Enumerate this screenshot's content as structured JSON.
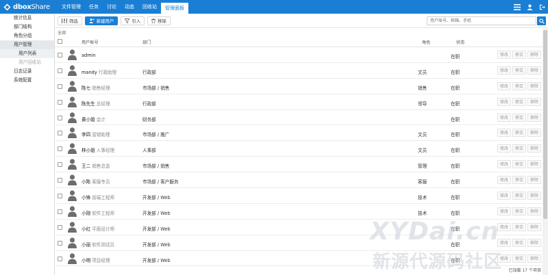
{
  "brand": {
    "name_bold": "dbox",
    "name_rest": "Share"
  },
  "nav": {
    "tabs": [
      {
        "label": "文件管理"
      },
      {
        "label": "任务"
      },
      {
        "label": "讨论"
      },
      {
        "label": "动态"
      },
      {
        "label": "回收站"
      },
      {
        "label": "管理面板"
      }
    ],
    "active": "管理面板"
  },
  "sidebar": {
    "items": [
      {
        "label": "统计信息"
      },
      {
        "label": "部门结构"
      },
      {
        "label": "角色分组"
      },
      {
        "label": "用户管理"
      },
      {
        "label": "日志记录"
      },
      {
        "label": "系统配置"
      }
    ],
    "sub": [
      {
        "label": "用户列表"
      },
      {
        "label": "用户回收站"
      }
    ]
  },
  "toolbar": {
    "filter_label": "筛选",
    "new_user_label": "新建用户",
    "import_label": "引入",
    "remove_label": "移除",
    "search_placeholder": "用户账号、邮箱、手机"
  },
  "crumb": "全部",
  "table": {
    "headers": {
      "user": "用户账号",
      "dept": "部门",
      "role": "角色",
      "status": "状态"
    },
    "action_labels": {
      "edit": "修改",
      "transfer": "移交",
      "remove": "移除"
    },
    "rows": [
      {
        "name": "admin",
        "title": "",
        "dept": "",
        "role": "",
        "status": "在职"
      },
      {
        "name": "mandy",
        "title": "行政助理",
        "dept": "行政部",
        "role": "文员",
        "status": "在职"
      },
      {
        "name": "陈七",
        "title": "销售经理",
        "dept": "市场部 / 销售",
        "role": "销售",
        "status": "在职"
      },
      {
        "name": "陈先生",
        "title": "总经理",
        "dept": "行政部",
        "role": "领导",
        "status": "在职"
      },
      {
        "name": "黄小姐",
        "title": "会计",
        "dept": "财务部",
        "role": "",
        "status": "在职"
      },
      {
        "name": "李四",
        "title": "营销助理",
        "dept": "市场部 / 推广",
        "role": "文员",
        "status": "在职"
      },
      {
        "name": "林小姐",
        "title": "人事经理",
        "dept": "人事部",
        "role": "文员",
        "status": "在职"
      },
      {
        "name": "王二",
        "title": "销售总监",
        "dept": "市场部 / 销售",
        "role": "管理",
        "status": "在职"
      },
      {
        "name": "小陈",
        "title": "客服专员",
        "dept": "市场部 / 客户服务",
        "role": "客服",
        "status": "在职"
      },
      {
        "name": "小锋",
        "title": "前端工程师",
        "dept": "开发部 / Web",
        "role": "技术",
        "status": "在职"
      },
      {
        "name": "小刚",
        "title": "软件工程师",
        "dept": "开发部 / Web",
        "role": "技术",
        "status": "在职"
      },
      {
        "name": "小红",
        "title": "平面设计师",
        "dept": "开发部 / Web",
        "role": "",
        "status": "在职"
      },
      {
        "name": "小丽",
        "title": "软件测试员",
        "dept": "开发部 / Web",
        "role": "",
        "status": "在职"
      },
      {
        "name": "小明",
        "title": "项目经理",
        "dept": "开发部 / Web",
        "role": "",
        "status": "在职"
      }
    ]
  },
  "footer": "已加载 17 个项目",
  "watermark": {
    "line1": "XYDai.cn",
    "line2": "新源代源码社区"
  },
  "colors": {
    "accent": "#1a7fd4"
  }
}
